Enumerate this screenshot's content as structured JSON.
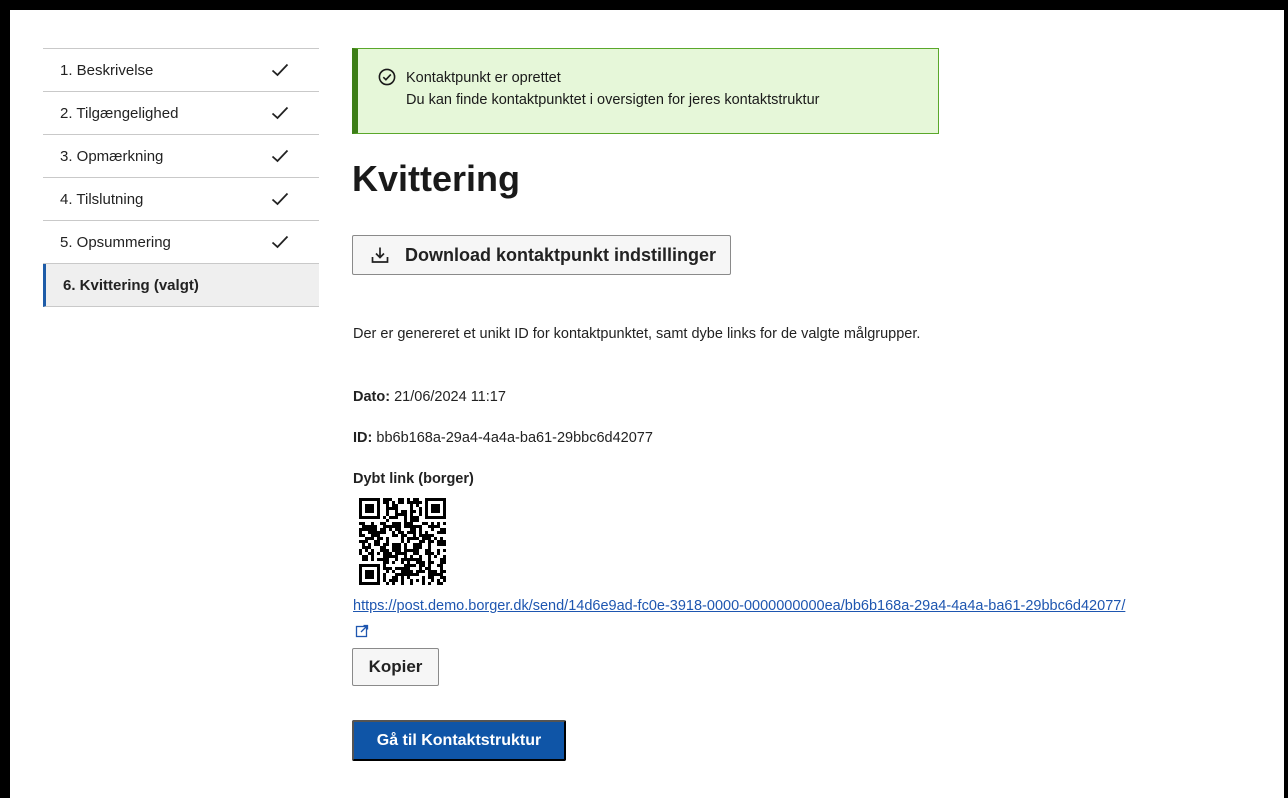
{
  "sidebar": {
    "steps": [
      {
        "label": "1. Beskrivelse",
        "done": true
      },
      {
        "label": "2. Tilgængelighed",
        "done": true
      },
      {
        "label": "3. Opmærkning",
        "done": true
      },
      {
        "label": "4. Tilslutning",
        "done": true
      },
      {
        "label": "5. Opsummering",
        "done": true
      },
      {
        "label": "6. Kvittering (valgt)",
        "done": false
      }
    ]
  },
  "alert": {
    "title": "Kontaktpunkt er oprettet",
    "message": "Du kan finde kontaktpunktet i oversigten for jeres kontaktstruktur",
    "icon": "check-circle-icon",
    "color": "#3d7e17"
  },
  "page": {
    "title": "Kvittering",
    "download_label": "Download kontaktpunkt indstillinger",
    "description": "Der er genereret et unikt ID for kontaktpunktet, samt dybe links for de valgte målgrupper.",
    "date_label": "Dato:",
    "date_value": "21/06/2024 11:17",
    "id_label": "ID:",
    "id_value": "bb6b168a-29a4-4a4a-ba61-29bbc6d42077",
    "deeplink_heading": "Dybt link (borger)",
    "deeplink_url": "https://post.demo.borger.dk/send/14d6e9ad-fc0e-3918-0000-0000000000ea/bb6b168a-29a4-4a4a-ba61-29bbc6d42077/",
    "copy_label": "Kopier",
    "primary_label": "Gå til Kontaktstruktur"
  },
  "colors": {
    "primary": "#0f55a7",
    "link": "#1e56b0",
    "success_bg": "#e6f7d9"
  }
}
